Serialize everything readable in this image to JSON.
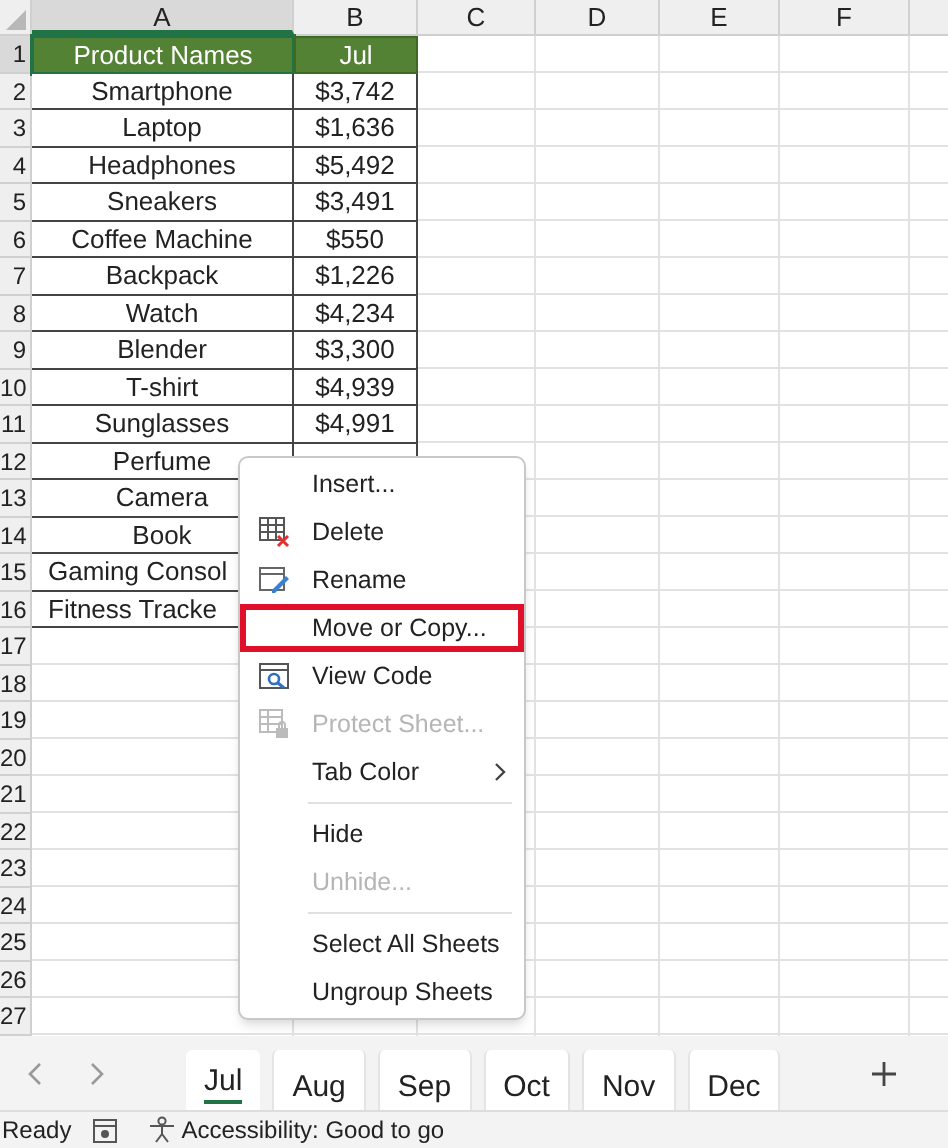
{
  "columns": [
    {
      "label": "A",
      "selected": true
    },
    {
      "label": "B",
      "selected": false
    },
    {
      "label": "C",
      "selected": false
    },
    {
      "label": "D",
      "selected": false
    },
    {
      "label": "E",
      "selected": false
    },
    {
      "label": "F",
      "selected": false
    }
  ],
  "rows": [
    {
      "number": "1",
      "selected": true,
      "kind": "header",
      "cells": [
        "Product Names",
        "Jul"
      ]
    },
    {
      "number": "2",
      "selected": false,
      "kind": "data",
      "cells": [
        "Smartphone",
        "$3,742"
      ]
    },
    {
      "number": "3",
      "selected": false,
      "kind": "data",
      "cells": [
        "Laptop",
        "$1,636"
      ]
    },
    {
      "number": "4",
      "selected": false,
      "kind": "data",
      "cells": [
        "Headphones",
        "$5,492"
      ]
    },
    {
      "number": "5",
      "selected": false,
      "kind": "data",
      "cells": [
        "Sneakers",
        "$3,491"
      ]
    },
    {
      "number": "6",
      "selected": false,
      "kind": "data",
      "cells": [
        "Coffee Machine",
        "$550"
      ]
    },
    {
      "number": "7",
      "selected": false,
      "kind": "data",
      "cells": [
        "Backpack",
        "$1,226"
      ]
    },
    {
      "number": "8",
      "selected": false,
      "kind": "data",
      "cells": [
        "Watch",
        "$4,234"
      ]
    },
    {
      "number": "9",
      "selected": false,
      "kind": "data",
      "cells": [
        "Blender",
        "$3,300"
      ]
    },
    {
      "number": "10",
      "selected": false,
      "kind": "data",
      "cells": [
        "T-shirt",
        "$4,939"
      ]
    },
    {
      "number": "11",
      "selected": false,
      "kind": "data",
      "cells": [
        "Sunglasses",
        "$4,991"
      ]
    },
    {
      "number": "12",
      "selected": false,
      "kind": "data",
      "cells": [
        "Perfume"
      ]
    },
    {
      "number": "13",
      "selected": false,
      "kind": "data",
      "cells": [
        "Camera"
      ]
    },
    {
      "number": "14",
      "selected": false,
      "kind": "data",
      "cells": [
        "Book"
      ]
    },
    {
      "number": "15",
      "selected": false,
      "kind": "cut",
      "cells": [
        "Gaming Consol"
      ]
    },
    {
      "number": "16",
      "selected": false,
      "kind": "cut",
      "cells": [
        "Fitness Tracke"
      ]
    },
    {
      "number": "17",
      "selected": false,
      "kind": "empty",
      "cells": []
    },
    {
      "number": "18",
      "selected": false,
      "kind": "empty",
      "cells": []
    },
    {
      "number": "19",
      "selected": false,
      "kind": "empty",
      "cells": []
    },
    {
      "number": "20",
      "selected": false,
      "kind": "empty",
      "cells": []
    },
    {
      "number": "21",
      "selected": false,
      "kind": "empty",
      "cells": []
    },
    {
      "number": "22",
      "selected": false,
      "kind": "empty",
      "cells": []
    },
    {
      "number": "23",
      "selected": false,
      "kind": "empty",
      "cells": []
    },
    {
      "number": "24",
      "selected": false,
      "kind": "empty",
      "cells": []
    },
    {
      "number": "25",
      "selected": false,
      "kind": "empty",
      "cells": []
    },
    {
      "number": "26",
      "selected": false,
      "kind": "empty",
      "cells": []
    },
    {
      "number": "27",
      "selected": false,
      "kind": "empty",
      "cells": []
    }
  ],
  "context_menu": [
    {
      "kind": "plain",
      "label": "Insert...",
      "disabled": false,
      "highlighted": false
    },
    {
      "kind": "delete",
      "label": "Delete",
      "disabled": false,
      "highlighted": false
    },
    {
      "kind": "rename",
      "label": "Rename",
      "disabled": false,
      "highlighted": false
    },
    {
      "kind": "plain",
      "label": "Move or Copy...",
      "disabled": false,
      "highlighted": true
    },
    {
      "kind": "code",
      "label": "View Code",
      "disabled": false,
      "highlighted": false
    },
    {
      "kind": "protect",
      "label": "Protect Sheet...",
      "disabled": true,
      "highlighted": false
    },
    {
      "kind": "submenu",
      "label": "Tab Color",
      "disabled": false,
      "highlighted": false
    },
    {
      "kind": "separator"
    },
    {
      "kind": "plain",
      "label": "Hide",
      "disabled": false,
      "highlighted": false
    },
    {
      "kind": "plain",
      "label": "Unhide...",
      "disabled": true,
      "highlighted": false
    },
    {
      "kind": "separator"
    },
    {
      "kind": "plain",
      "label": "Select All Sheets",
      "disabled": false,
      "highlighted": false
    },
    {
      "kind": "plain",
      "label": "Ungroup Sheets",
      "disabled": false,
      "highlighted": false
    }
  ],
  "sheet_tabs": [
    {
      "label": "Jul",
      "selected": true
    },
    {
      "label": "Aug",
      "selected": false
    },
    {
      "label": "Sep",
      "selected": false
    },
    {
      "label": "Oct",
      "selected": false
    },
    {
      "label": "Nov",
      "selected": false
    },
    {
      "label": "Dec",
      "selected": false
    }
  ],
  "status_bar": {
    "state": "Ready",
    "accessibility": "Accessibility: Good to go"
  }
}
